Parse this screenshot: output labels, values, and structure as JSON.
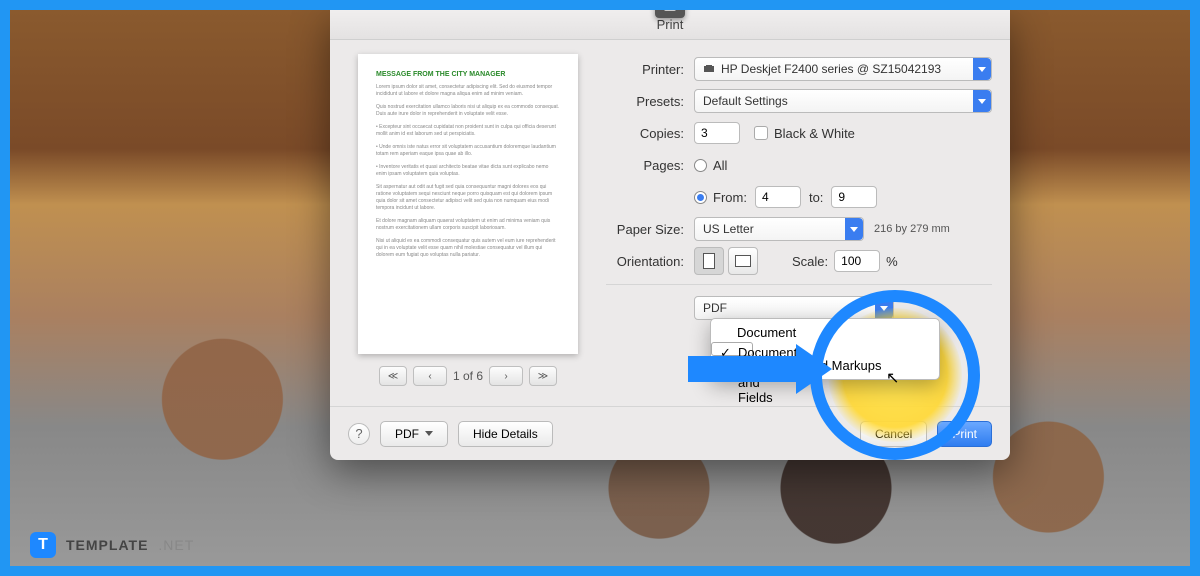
{
  "dialog": {
    "title": "Print",
    "printer_label": "Printer:",
    "printer_value": "HP Deskjet F2400 series @ SZ15042193",
    "presets_label": "Presets:",
    "presets_value": "Default Settings",
    "copies_label": "Copies:",
    "copies_value": "3",
    "bw_label": "Black & White",
    "pages_label": "Pages:",
    "pages_all": "All",
    "pages_from_label": "From:",
    "pages_from": "4",
    "pages_to_label": "to:",
    "pages_to": "9",
    "paper_label": "Paper Size:",
    "paper_value": "US Letter",
    "paper_note": "216 by 279 mm",
    "orientation_label": "Orientation:",
    "scale_label": "Scale:",
    "scale_value": "100",
    "scale_pct": "%",
    "layout_dd": "PDF",
    "submenu": {
      "i1": "Document",
      "i2": "Document, Markups and Fields",
      "i3": "Documents and Markups"
    },
    "footer": {
      "pdf": "PDF",
      "hide": "Hide Details",
      "cancel": "Cancel",
      "print": "Print"
    },
    "pager": {
      "count": "1 of 6"
    },
    "preview_heading": "MESSAGE FROM THE CITY MANAGER"
  },
  "brand": {
    "t1": "TEMPLATE",
    "t2": ".NET"
  }
}
